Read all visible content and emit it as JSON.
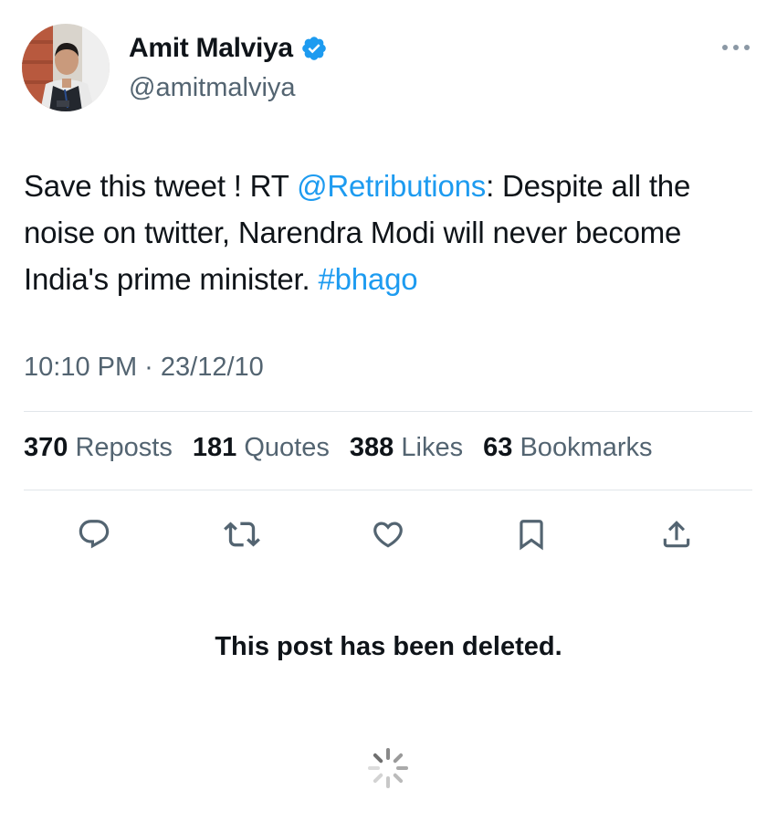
{
  "author": {
    "display_name": "Amit Malviya",
    "handle": "@amitmalviya",
    "verified_icon": "verified-badge-icon",
    "verified_color": "#1d9bf0"
  },
  "tweet": {
    "text_before": "Save this tweet ! RT ",
    "mention": "@Retributions",
    "text_middle": ": Despite all the noise on twitter, Narendra Modi will never become India's prime minister. ",
    "hashtag": "#bhago",
    "timestamp": "10:10 PM · 23/12/10"
  },
  "stats": [
    {
      "count": "370",
      "label": "Reposts"
    },
    {
      "count": "181",
      "label": "Quotes"
    },
    {
      "count": "388",
      "label": "Likes"
    },
    {
      "count": "63",
      "label": "Bookmarks"
    }
  ],
  "actions": [
    "reply-icon",
    "repost-icon",
    "like-icon",
    "bookmark-icon",
    "share-icon"
  ],
  "status": {
    "deleted_message": "This post has been deleted."
  },
  "colors": {
    "link": "#1d9bf0",
    "secondary_text": "#536471",
    "primary_text": "#0f1419"
  }
}
